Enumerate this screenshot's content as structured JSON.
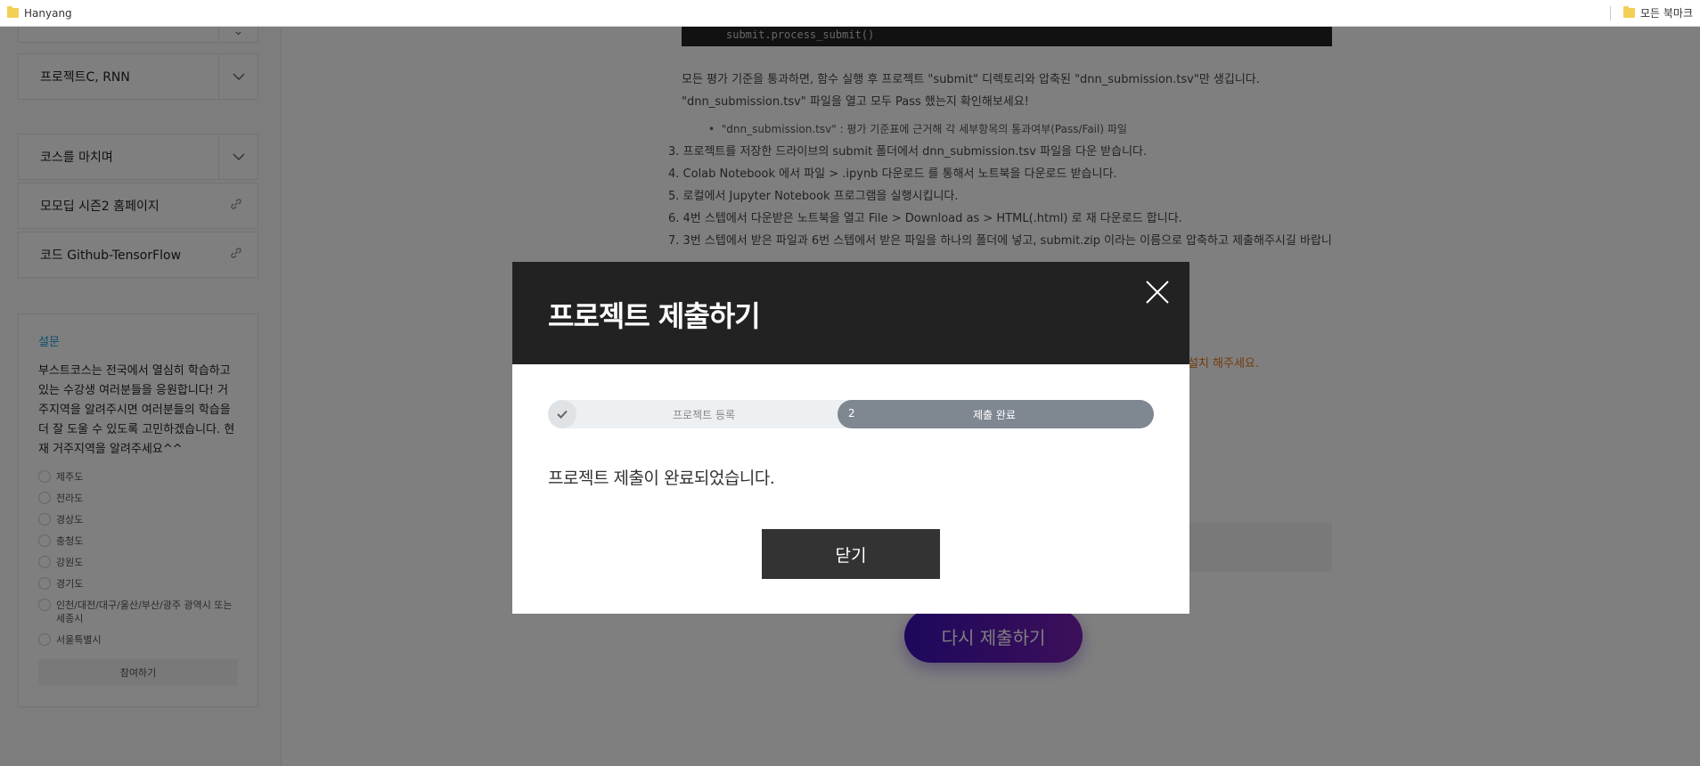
{
  "bookmarks": {
    "left": "Hanyang",
    "right": "모든 북마크"
  },
  "sidebar": {
    "items": [
      {
        "label": "프로젝트C, RNN",
        "type": "chevron"
      },
      {
        "label": "코스를 마치며",
        "type": "chevron"
      },
      {
        "label": "모모딥 시즌2 홈페이지",
        "type": "link"
      },
      {
        "label": "코드 Github-TensorFlow",
        "type": "link"
      }
    ],
    "survey": {
      "title": "설문",
      "question": "부스트코스는 전국에서 열심히 학습하고 있는 수강생 여러분들을 응원합니다! 거주지역을 알려주시면 여러분들의 학습을 더 잘 도울 수 있도록 고민하겠습니다. 현재 거주지역을 알려주세요^^",
      "options": [
        "제주도",
        "전라도",
        "경상도",
        "충청도",
        "강원도",
        "경기도",
        "인천/대전/대구/울산/부산/광주 광역시 또는 세종시",
        "서울특별시"
      ],
      "submit": "참여하기"
    }
  },
  "main": {
    "code": "submit.process_submit()",
    "paragraph": "모든 평가 기준을 통과하면, 함수 실행 후 프로젝트 \"submit\" 디렉토리와 압축된 \"dnn_submission.tsv\"만 생깁니다.  \"dnn_submission.tsv\" 파일을 열고 모두 Pass 했는지 확인해보세요!",
    "bullet": "\"dnn_submission.tsv\" : 평가 기준표에 근거해 각 세부항목의 통과여부(Pass/Fail) 파일",
    "steps": [
      "3. 프로젝트를 저장한 드라이브의 submit 폴더에서 dnn_submission.tsv 파일을 다운 받습니다.",
      "4. Colab Notebook 에서 파일 > .ipynb 다운로드 를 통해서 노트북을 다운로드 받습니다.",
      "5. 로컬에서 Jupyter Notebook 프로그램을 실행시킵니다.",
      "6. 4번 스텝에서 다운받은 노트북을 열고 File > Download as > HTML(.html) 로 재 다운로드 합니다.",
      "7. 3번 스텝에서 받은 파일과 6번 스텝에서 받은 파일을 하나의 폴더에 넣고, submit.zip 이라는 이름으로 압축하고 제출해주시길 바랍니"
    ],
    "orange_note": "설치 해주세요.",
    "resubmit_label": "다시 제출하기"
  },
  "modal": {
    "title": "프로젝트 제출하기",
    "step1_label": "프로젝트 등록",
    "step2_number": "2",
    "step2_label": "제출 완료",
    "message": "프로젝트 제출이 완료되었습니다.",
    "close_label": "닫기"
  },
  "colors": {
    "header": "#222222",
    "active_step": "#7f8791",
    "resubmit_start": "#3b11b9",
    "resubmit_end": "#7a1fb5",
    "survey_title": "#1aa1d6",
    "note": "#e77a1a"
  }
}
